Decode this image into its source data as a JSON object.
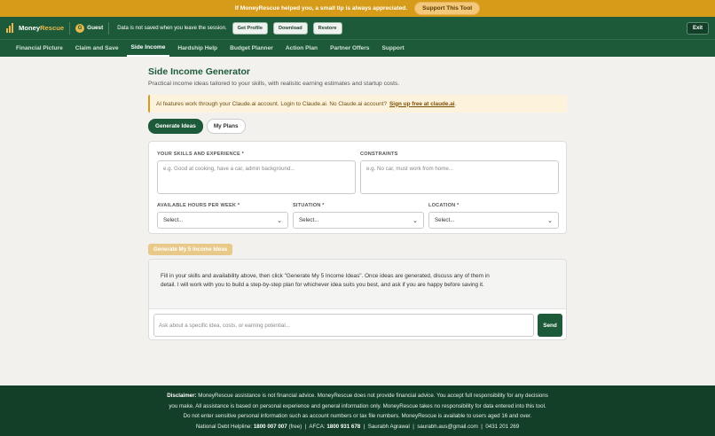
{
  "tipbar": {
    "text": "If MoneyRescue helped you, a small tip is always appreciated.",
    "button": "Support This Tool"
  },
  "header": {
    "brand_main": "Money",
    "brand_accent": "Rescue",
    "guest_initial": "G",
    "guest_label": "Guest",
    "notice": "Data is not saved when you leave the session.",
    "buttons": [
      "Get Profile",
      "Download",
      "Restore"
    ],
    "exit": "Exit"
  },
  "nav": {
    "items": [
      "Financial Picture",
      "Claim and Save",
      "Side Income",
      "Hardship Help",
      "Budget Planner",
      "Action Plan",
      "Partner Offers",
      "Support"
    ],
    "active": "Side Income"
  },
  "main": {
    "title": "Side Income Generator",
    "subtitle": "Practical income ideas tailored to your skills, with realistic earning estimates and startup costs.",
    "ai_notice": "AI features work through your Claude.ai account. Login to Claude.ai. No Claude.ai account?",
    "ai_link": "Sign up free at claude.ai",
    "ai_trailing": ".",
    "tabs": [
      "Generate Ideas",
      "My Plans"
    ]
  },
  "form": {
    "skills_label": "YOUR SKILLS AND EXPERIENCE *",
    "skills_placeholder": "e.g. Good at cooking, have a car, admin background...",
    "constraints_label": "CONSTRAINTS",
    "constraints_placeholder": "e.g. No car, must work from home...",
    "hours_label": "AVAILABLE HOURS PER WEEK *",
    "hours_value": "Select...",
    "situation_label": "SITUATION *",
    "situation_value": "Select...",
    "location_label": "LOCATION *",
    "location_value": "Select...",
    "generate_button": "Generate My 5 Income Ideas"
  },
  "chat": {
    "message": "Fill in your skills and availability above, then click \"Generate My 5 Income Ideas\". Once ideas are generated, discuss any of them in detail. I will work with you to build a step-by-step plan for whichever idea suits you best, and ask if you are happy before saving it.",
    "input_placeholder": "Ask about a specific idea, costs, or earning potential...",
    "send": "Send"
  },
  "footer": {
    "disclaimer_label": "Disclaimer:",
    "line1": "MoneyRescue assistance is not financial advice. MoneyRescue does not provide financial advice. You accept full responsibility for any decisions",
    "line2": "you make. All assistance is based on personal experience and general information only. MoneyRescue takes no responsibility for data entered into this tool.",
    "line3": "Do not enter sensitive personal information such as account numbers or tax file numbers. MoneyRescue is available to users aged 16 and over.",
    "helpline_label": "National Debt Helpline:",
    "helpline_number": "1800 007 007",
    "helpline_suffix": "(free)",
    "afca_label": "AFCA:",
    "afca_number": "1800 931 678",
    "name": "Saurabh Agrawal",
    "email": "saurabh.aus@gmail.com",
    "phone": "0431 201 269"
  },
  "colors": {
    "brand_green": "#1d5a3a",
    "accent_gold": "#d79b1a",
    "footer_green": "#133e28"
  }
}
